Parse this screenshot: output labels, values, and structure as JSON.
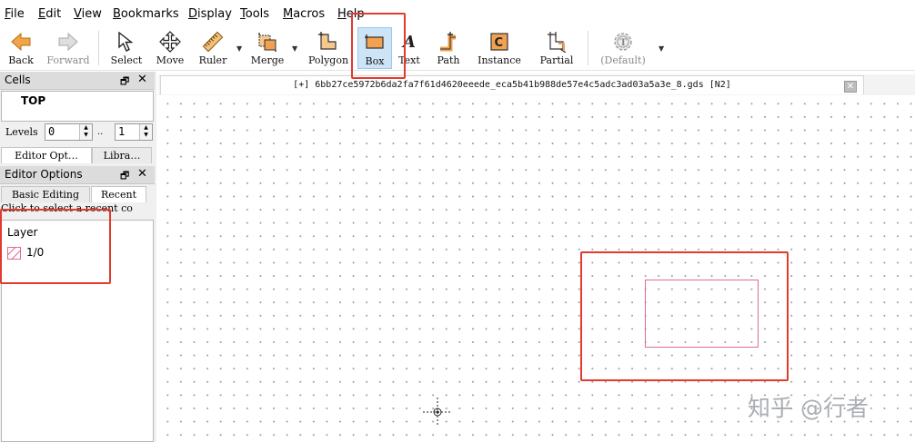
{
  "menu": [
    {
      "id": "file",
      "label": "File",
      "mnemonic_index": 0
    },
    {
      "id": "edit",
      "label": "Edit",
      "mnemonic_index": 0
    },
    {
      "id": "view",
      "label": "View",
      "mnemonic_index": 0
    },
    {
      "id": "bookmarks",
      "label": "Bookmarks",
      "mnemonic_index": 0
    },
    {
      "id": "display",
      "label": "Display",
      "mnemonic_index": 0
    },
    {
      "id": "tools",
      "label": "Tools",
      "mnemonic_index": 0
    },
    {
      "id": "macros",
      "label": "Macros",
      "mnemonic_index": 0
    },
    {
      "id": "help",
      "label": "Help",
      "mnemonic_index": 0
    }
  ],
  "toolbar": [
    {
      "id": "back",
      "label": "Back",
      "icon": "back-arrow-icon",
      "enabled": true
    },
    {
      "id": "forward",
      "label": "Forward",
      "icon": "forward-arrow-icon",
      "enabled": false
    },
    {
      "id": "select",
      "label": "Select",
      "icon": "cursor-icon",
      "enabled": true
    },
    {
      "id": "move",
      "label": "Move",
      "icon": "move-icon",
      "enabled": true
    },
    {
      "id": "ruler",
      "label": "Ruler",
      "icon": "ruler-icon",
      "enabled": true,
      "dropdown": true
    },
    {
      "id": "merge",
      "label": "Merge",
      "icon": "merge-icon",
      "enabled": true,
      "dropdown": true
    },
    {
      "id": "polygon",
      "label": "Polygon",
      "icon": "polygon-icon",
      "enabled": true
    },
    {
      "id": "box",
      "label": "Box",
      "icon": "box-icon",
      "enabled": true,
      "active": true
    },
    {
      "id": "text",
      "label": "Text",
      "icon": "text-icon",
      "enabled": true
    },
    {
      "id": "path",
      "label": "Path",
      "icon": "path-icon",
      "enabled": true
    },
    {
      "id": "instance",
      "label": "Instance",
      "icon": "instance-icon",
      "enabled": true
    },
    {
      "id": "partial",
      "label": "Partial",
      "icon": "partial-icon",
      "enabled": true
    },
    {
      "id": "default",
      "label": "(Default)",
      "icon": "technology-icon",
      "enabled": false,
      "dropdown": true
    }
  ],
  "cells_panel": {
    "title": "Cells",
    "items": [
      "TOP"
    ],
    "levels_label": "Levels",
    "level_min": "0",
    "level_sep": "..",
    "level_max": "1",
    "tabs": [
      "Editor Opt…",
      "Libra…"
    ]
  },
  "editor_panel": {
    "title": "Editor Options",
    "tabs": [
      "Basic Editing",
      "Recent"
    ],
    "selected_tab": "Recent",
    "hint": "Click to select a recent co",
    "layer_header": "Layer",
    "layers": [
      {
        "name": "1/0",
        "color": "#e06b8a"
      }
    ]
  },
  "document_tab": {
    "title": "[+] 6bb27ce5972b6da2fa7f61d4620eeede_eca5b41b988de57e4c5adc3ad03a5a3e_8.gds [N2]"
  },
  "watermark": "知乎 @行者",
  "colors": {
    "accent_red": "#e23a2e",
    "box_shape": "#e06b8a",
    "active_tool_bg": "#cde4f7",
    "panel_header": "#dcdcdc"
  }
}
